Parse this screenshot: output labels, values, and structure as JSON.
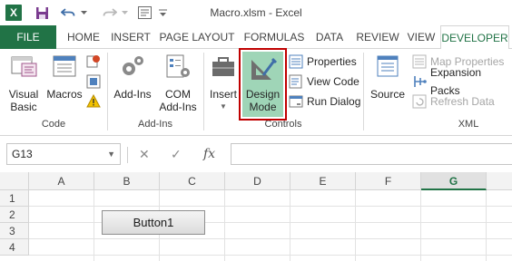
{
  "window": {
    "title": "Macro.xlsm - Excel",
    "app_logo": "X"
  },
  "qat": {
    "icons": [
      "excel-logo-icon",
      "save-icon",
      "undo-icon",
      "redo-icon",
      "customize-qat-icon"
    ]
  },
  "tabs": [
    {
      "label": "FILE"
    },
    {
      "label": "HOME"
    },
    {
      "label": "INSERT"
    },
    {
      "label": "PAGE LAYOUT"
    },
    {
      "label": "FORMULAS"
    },
    {
      "label": "DATA"
    },
    {
      "label": "REVIEW"
    },
    {
      "label": "VIEW"
    },
    {
      "label": "DEVELOPER"
    }
  ],
  "active_tab": "DEVELOPER",
  "ribbon": {
    "code": {
      "label": "Code",
      "visual_basic": [
        "Visual",
        "Basic"
      ],
      "macros": "Macros"
    },
    "addins": {
      "label": "Add-Ins",
      "addins": "Add-Ins",
      "com_addins": [
        "COM",
        "Add-Ins"
      ]
    },
    "controls": {
      "label": "Controls",
      "insert": "Insert",
      "design_mode": [
        "Design",
        "Mode"
      ],
      "properties": "Properties",
      "view_code": "View Code",
      "run_dialog": "Run Dialog"
    },
    "xml": {
      "label": "XML",
      "source": "Source",
      "map_properties": "Map Properties",
      "expansion_packs": "Expansion Packs",
      "refresh_data": "Refresh Data"
    }
  },
  "formula_bar": {
    "name_box": "G13",
    "fx": "fx",
    "cancel": "✕",
    "enter": "✓",
    "value": ""
  },
  "sheet": {
    "columns": [
      "A",
      "B",
      "C",
      "D",
      "E",
      "F",
      "G"
    ],
    "selected_column": "G",
    "rows": [
      "1",
      "2",
      "3",
      "4"
    ],
    "button_label": "Button1"
  },
  "colors": {
    "brand": "#217346",
    "highlight_border": "#c00000",
    "design_mode_fill": "#9fd5b7"
  }
}
